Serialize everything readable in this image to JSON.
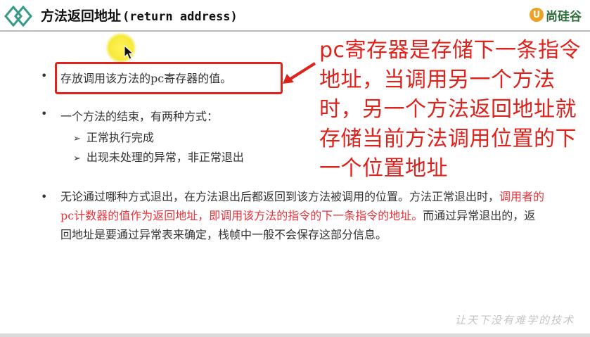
{
  "header": {
    "title_cn": "方法返回地址",
    "title_en": "(return address)",
    "logo_text": "尚硅谷",
    "logo_mark": "U"
  },
  "bullets": {
    "b1": "存放调用该方法的pc寄存器的值。",
    "b2": "一个方法的结束，有两种方式：",
    "b2_sub1": "正常执行完成",
    "b2_sub2": "出现未处理的异常，非正常退出",
    "b3_part1": "无论通过哪种方式退出，在方法退出后都返回到该方法被调用的位置。方法正常退出时，",
    "b3_red": "调用者的pc计数器的值作为返回地址，即调用该方法的指令的下一条指令的地址。",
    "b3_part2": "而通过异常退出的，返回地址是要通过异常表来确定，栈帧中一般不会保存这部分信息。",
    "bullet_symbol": "•",
    "sub_symbol": "➢"
  },
  "annotation": {
    "text": "pc寄存器是存储下一条指令地址，当调用另一个方法时，另一个方法返回地址就存储当前方法调用位置的下一个位置地址",
    "color": "#e0221c"
  },
  "watermark": "让天下没有难学的技术",
  "colors": {
    "highlight_red": "#e8323a",
    "box_red": "#e0221c",
    "logo_green": "#2d6f3a",
    "logo_orange": "#f0a020"
  }
}
